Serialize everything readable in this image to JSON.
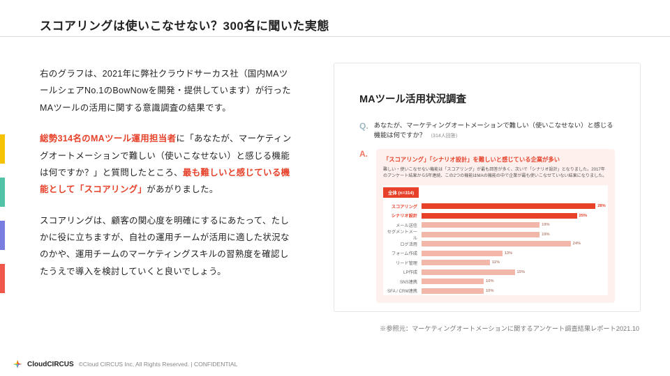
{
  "title": "スコアリングは使いこなせない？300名に聞いた実態",
  "body": {
    "p1": "右のグラフは、2021年に弊社クラウドサーカス社（国内MAツールシェアNo.1のBowNowを開発・提供しています）が行ったMAツールの活用に関する意識調査の結果です。",
    "p2a": "総勢314名のMAツール運用担当者",
    "p2b": "に「あなたが、マーケティングオートメーションで難しい（使いこなせない）と感じる機能は何ですか？」と質問したところ、",
    "p2c": "最も難しいと感じている機能として「スコアリング」",
    "p2d": "があがりました。",
    "p3": "スコアリングは、顧客の関心度を明確にするにあたって、たしかに役に立ちますが、自社の運用チームが活用に適した状況なのかや、運用チームのマーケティングスキルの習熟度を確認したうえで導入を検討していくと良いでしょう。"
  },
  "accents": [
    "#f6c300",
    "#52c3a6",
    "#7a7de0",
    "#f0584b"
  ],
  "card": {
    "title": "MAツール活用状況調査",
    "q_letter": "Q.",
    "q_text": "あなたが、マーケティングオートメーションで難しい（使いこなせない）と感じる機能は何ですか？",
    "q_note": "（314人回答）",
    "a_letter": "A.",
    "a_head": "「スコアリング」「シナリオ設計」を難しいと感じている企業が多い",
    "a_sub": "難しい・使いこなせない機能は「スコアリング」が最も回答が多く、次いで「シナリオ設計」となりました。2017年のアンケート結果から5年連続、この2つの機能はMAの機能の中で企業が最も使いこなせていない結果になりました。",
    "chart_header": "全体 (n=314)"
  },
  "chart_data": {
    "type": "bar",
    "orientation": "horizontal",
    "title": "MAツール活用状況調査",
    "xlabel": "%",
    "ylabel": "",
    "xlim": [
      0,
      30
    ],
    "categories": [
      "スコアリング",
      "シナリオ設計",
      "メール送信",
      "セグメントメール",
      "ログ活用",
      "フォーム作成",
      "リード管理",
      "LP作成",
      "SNS連携",
      "SFA / CRM連携"
    ],
    "values": [
      28,
      25,
      19,
      19,
      24,
      13,
      11,
      15,
      10,
      10
    ],
    "highlight_index": [
      0,
      1
    ],
    "colors": {
      "highlight": "#e7412a",
      "normal": "#f3b7aa"
    }
  },
  "citation": "※参照元：マーケティングオートメーションに関するアンケート調査結果レポート2021.10",
  "footer": {
    "logo1": "Cloud",
    "logo2": "CIRCUS",
    "copy": "©Cloud CIRCUS Inc, All Rights Reserved. | CONFIDENTIAL"
  }
}
